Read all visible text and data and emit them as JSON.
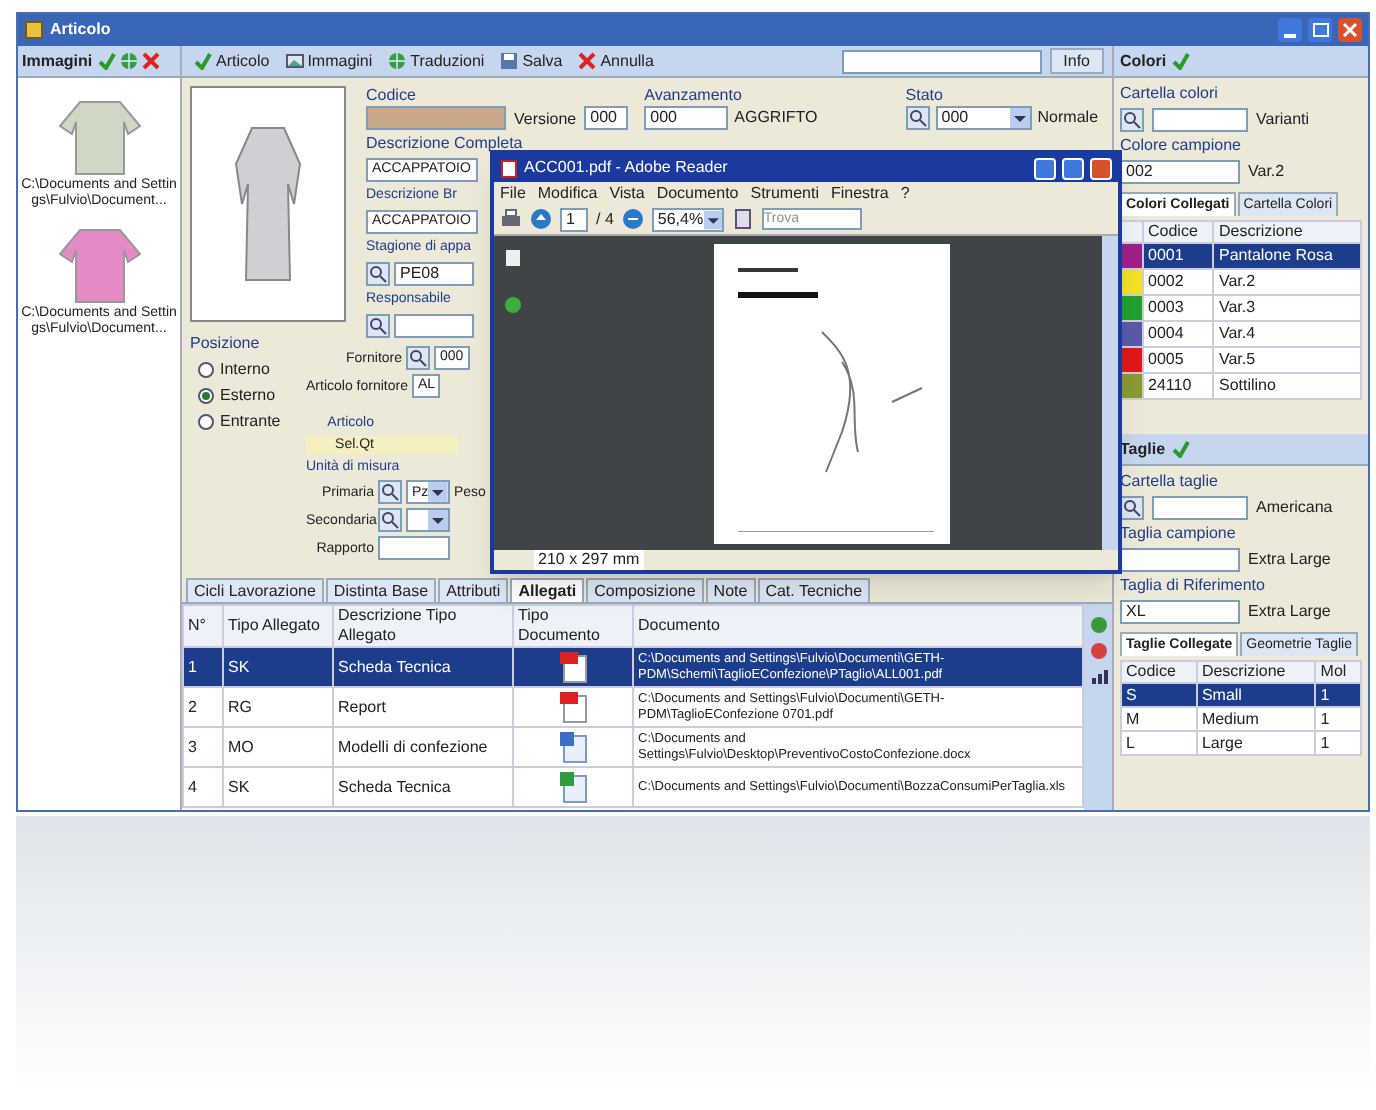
{
  "window": {
    "title": "Articolo"
  },
  "images_panel": {
    "title": "Immagini",
    "items": [
      {
        "caption": "C:\\Documents and Settings\\Fulvio\\Document...",
        "color": "#cfd8c4"
      },
      {
        "caption": "C:\\Documents and Settings\\Fulvio\\Document...",
        "color": "#e58ac4"
      }
    ]
  },
  "toolbar": {
    "buttons": [
      {
        "label": "Articolo",
        "kind": "check"
      },
      {
        "label": "Immagini",
        "kind": "image"
      },
      {
        "label": "Traduzioni",
        "kind": "globe"
      },
      {
        "label": "Salva",
        "kind": "save"
      },
      {
        "label": "Annulla",
        "kind": "cancel"
      }
    ],
    "info_button": "Info"
  },
  "form": {
    "codice": {
      "label": "Codice"
    },
    "versione": {
      "label": "Versione",
      "value": "000"
    },
    "avanzamento": {
      "label": "Avanzamento",
      "value": "000",
      "description": "AGGRIFTO"
    },
    "stato": {
      "label": "Stato",
      "value": "000",
      "description": "Normale"
    },
    "descrizione_completa": {
      "label": "Descrizione Completa",
      "value": "ACCAPPATOIO"
    },
    "descrizione_breve": {
      "label": "Descrizione Br",
      "value": "ACCAPPATOIO"
    },
    "stagione": {
      "label": "Stagione di appa",
      "value": "PE08"
    },
    "responsabile": {
      "label": "Responsabile"
    },
    "posizione": {
      "label": "Posizione",
      "options": [
        {
          "label": "Interno",
          "selected": false
        },
        {
          "label": "Esterno",
          "selected": true
        },
        {
          "label": "Entrante",
          "selected": false
        }
      ]
    },
    "fornitore": {
      "label": "Fornitore",
      "value": "000"
    },
    "articolo_fornitore": {
      "label": "Articolo fornitore",
      "value": "AL"
    },
    "articolo": {
      "label": "Articolo"
    },
    "sel": {
      "label": "Sel.Qt"
    },
    "unita_misura": {
      "label": "Unità di misura",
      "primaria": {
        "label": "Primaria",
        "value": "Pz"
      },
      "peso": "Peso",
      "secondaria": {
        "label": "Secondaria"
      },
      "rapporto": {
        "label": "Rapporto"
      }
    }
  },
  "reader": {
    "title": "ACC001.pdf - Adobe Reader",
    "menu": [
      "File",
      "Modifica",
      "Vista",
      "Documento",
      "Strumenti",
      "Finestra",
      "?"
    ],
    "page": "1",
    "page_count": "/ 4",
    "zoom": "56,4%",
    "find_placeholder": "Trova",
    "page_size": "210 x 297 mm"
  },
  "bottom_tabs": [
    {
      "label": "Cicli Lavorazione",
      "selected": false
    },
    {
      "label": "Distinta Base",
      "selected": false
    },
    {
      "label": "Attributi",
      "selected": false
    },
    {
      "label": "Allegati",
      "selected": true
    },
    {
      "label": "Composizione",
      "selected": false
    },
    {
      "label": "Note",
      "selected": false
    },
    {
      "label": "Cat. Tecniche",
      "selected": false
    }
  ],
  "attachments": {
    "columns": [
      "N°",
      "Tipo Allegato",
      "Descrizione Tipo Allegato",
      "Tipo Documento",
      "Documento"
    ],
    "rows": [
      {
        "n": "1",
        "tipo": "SK",
        "descrizione": "Scheda Tecnica",
        "kind": "pdf",
        "documento": "C:\\Documents and Settings\\Fulvio\\Documenti\\GETH-PDM\\Schemi\\TaglioEConfezione\\PTaglio\\ALL001.pdf",
        "selected": true
      },
      {
        "n": "2",
        "tipo": "RG",
        "descrizione": "Report",
        "kind": "pdf",
        "documento": "C:\\Documents and Settings\\Fulvio\\Documenti\\GETH-PDM\\TaglioEConfezione 0701.pdf",
        "selected": false
      },
      {
        "n": "3",
        "tipo": "MO",
        "descrizione": "Modelli di confezione",
        "kind": "word",
        "documento": "C:\\Documents and Settings\\Fulvio\\Desktop\\PreventivoCostoConfezione.docx",
        "selected": false
      },
      {
        "n": "4",
        "tipo": "SK",
        "descrizione": "Scheda Tecnica",
        "kind": "excel",
        "documento": "C:\\Documents and Settings\\Fulvio\\Documenti\\BozzaConsumiPerTaglia.xls",
        "selected": false
      }
    ]
  },
  "colors_panel": {
    "title": "Colori",
    "cartella": {
      "label": "Cartella colori",
      "description": "Varianti"
    },
    "campione": {
      "label": "Colore campione",
      "value": "002",
      "description": "Var.2"
    },
    "tabs": [
      {
        "label": "Colori Collegati",
        "selected": true
      },
      {
        "label": "Cartella Colori",
        "selected": false
      }
    ],
    "columns": [
      "Codice",
      "Descrizione"
    ],
    "rows": [
      {
        "code": "0001",
        "description": "Pantalone Rosa",
        "color": "#a0208a",
        "selected": true
      },
      {
        "code": "0002",
        "description": "Var.2",
        "color": "#f2e228",
        "selected": false
      },
      {
        "code": "0003",
        "description": "Var.3",
        "color": "#22a030",
        "selected": false
      },
      {
        "code": "0004",
        "description": "Var.4",
        "color": "#5a5aa8",
        "selected": false
      },
      {
        "code": "0005",
        "description": "Var.5",
        "color": "#e01818",
        "selected": false
      },
      {
        "code": "24110",
        "description": "Sottilino",
        "color": "#8a9a30",
        "selected": false
      }
    ]
  },
  "sizes_panel": {
    "title": "Taglie",
    "cartella": {
      "label": "Cartella taglie",
      "description": "Americana"
    },
    "campione": {
      "label": "Taglia campione",
      "description": "Extra Large"
    },
    "riferimento": {
      "label": "Taglia di Riferimento",
      "value": "XL",
      "description": "Extra Large"
    },
    "tabs": [
      {
        "label": "Taglie Collegate",
        "selected": true
      },
      {
        "label": "Geometrie Taglie",
        "selected": false
      }
    ],
    "columns": [
      "Codice",
      "Descrizione",
      "Mol"
    ],
    "rows": [
      {
        "code": "S",
        "description": "Small",
        "mol": "1",
        "selected": true
      },
      {
        "code": "M",
        "description": "Medium",
        "mol": "1",
        "selected": false
      },
      {
        "code": "L",
        "description": "Large",
        "mol": "1",
        "selected": false
      }
    ]
  }
}
